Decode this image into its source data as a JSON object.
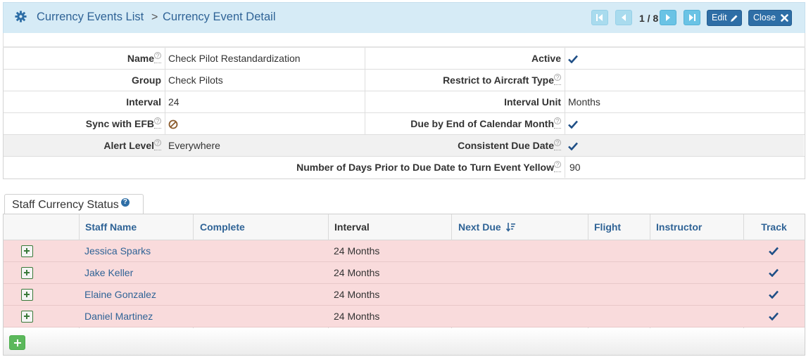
{
  "breadcrumb": {
    "parent": "Currency Events List",
    "separator": ">",
    "current": "Currency Event Detail"
  },
  "pager": {
    "text": "1 / 8",
    "current": 1,
    "total": 8
  },
  "actions": {
    "edit_label": "Edit",
    "close_label": "Close"
  },
  "icons": {
    "settings": "gear-icon",
    "first": "first-page-icon",
    "prev": "prev-page-icon",
    "next": "next-page-icon",
    "last": "last-page-icon",
    "edit": "pencil-icon",
    "close": "x-icon",
    "help": "question-circle-icon",
    "check": "check-icon",
    "disabled": "ban-icon",
    "sort": "sort-desc-icon"
  },
  "detail": {
    "name_label": "Name",
    "name_value": "Check Pilot Restandardization",
    "active_label": "Active",
    "active_value": true,
    "group_label": "Group",
    "group_value": "Check Pilots",
    "restrict_label": "Restrict to Aircraft Type",
    "restrict_value": "",
    "interval_label": "Interval",
    "interval_value": "24",
    "interval_unit_label": "Interval Unit",
    "interval_unit_value": "Months",
    "sync_label": "Sync with EFB",
    "sync_value": false,
    "due_eom_label": "Due by End of Calendar Month",
    "due_eom_value": true,
    "alert_label": "Alert Level",
    "alert_value": "Everywhere",
    "consistent_label": "Consistent Due Date",
    "consistent_value": true,
    "yellow_label": "Number of Days Prior to Due Date to Turn Event Yellow",
    "yellow_value": "90",
    "help_glyph": "?"
  },
  "staff": {
    "tab_label": "Staff Currency Status",
    "tab_help": "?",
    "columns": {
      "staff_name": "Staff Name",
      "complete": "Complete",
      "interval": "Interval",
      "next_due": "Next Due",
      "flight": "Flight",
      "instructor": "Instructor",
      "track": "Track"
    },
    "rows": [
      {
        "name": "Jessica Sparks",
        "complete": "",
        "interval": "24 Months",
        "next_due": "",
        "flight": "",
        "instructor": "",
        "track": true
      },
      {
        "name": "Jake Keller",
        "complete": "",
        "interval": "24 Months",
        "next_due": "",
        "flight": "",
        "instructor": "",
        "track": true
      },
      {
        "name": "Elaine Gonzalez",
        "complete": "",
        "interval": "24 Months",
        "next_due": "",
        "flight": "",
        "instructor": "",
        "track": true
      },
      {
        "name": "Daniel Martinez",
        "complete": "",
        "interval": "24 Months",
        "next_due": "",
        "flight": "",
        "instructor": "",
        "track": true
      }
    ]
  },
  "colors": {
    "header_bg": "#d6ebf6",
    "link": "#2f6396",
    "primary_button": "#2e6ea6",
    "nav_button": "#6ac3e5",
    "row_overdue": "#f9dbdc",
    "add_button": "#5cb85c",
    "check": "#1f4f86"
  }
}
